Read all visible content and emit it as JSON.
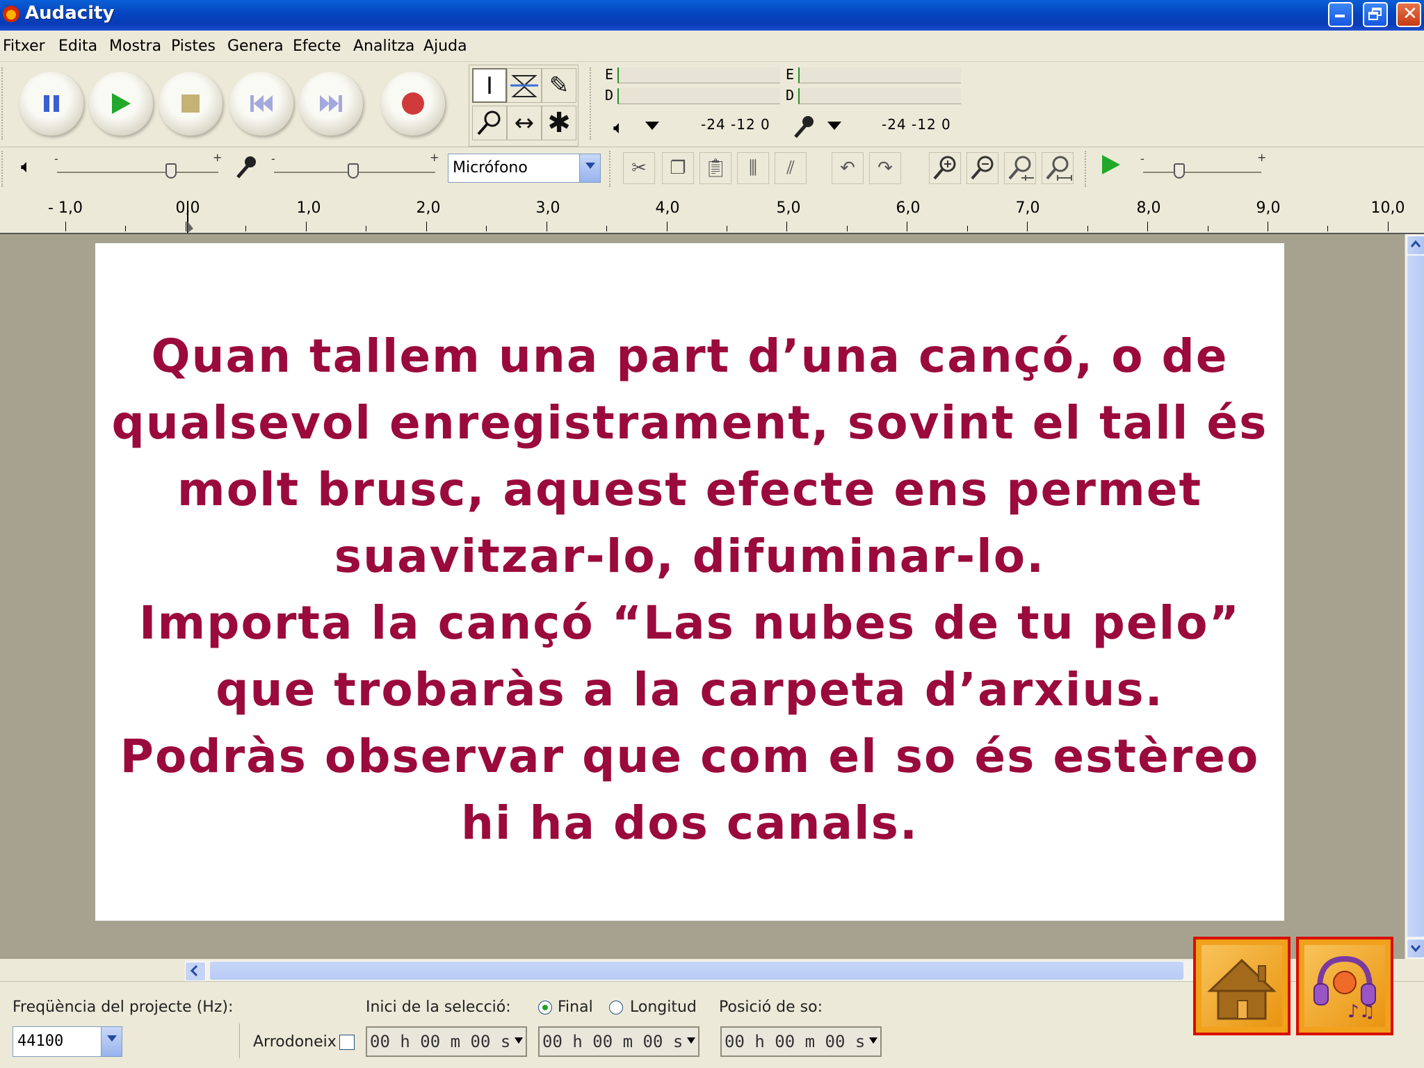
{
  "window": {
    "title": "Audacity"
  },
  "menu": [
    "Fitxer",
    "Edita",
    "Mostra",
    "Pistes",
    "Genera",
    "Efecte",
    "Analitza",
    "Ajuda"
  ],
  "icons": {
    "transport": [
      "pause-icon",
      "play-icon",
      "stop-icon",
      "skip-start-icon",
      "skip-end-icon",
      "record-icon"
    ],
    "tools": [
      "selection-tool-icon",
      "envelope-tool-icon",
      "draw-tool-icon",
      "zoom-tool-icon",
      "timeshift-tool-icon",
      "multi-tool-icon"
    ],
    "edit": [
      "trim-icon",
      "copy-icon",
      "paste-icon",
      "silence-icon",
      "split-icon",
      "undo-icon",
      "redo-icon",
      "zoom-in-icon",
      "zoom-out-icon",
      "fit-selection-icon",
      "fit-project-icon",
      "play-at-speed-icon"
    ]
  },
  "meters": {
    "output": {
      "channel_labels": [
        "E",
        "D"
      ],
      "scale": "-24  -12   0"
    },
    "input": {
      "channel_labels": [
        "E",
        "D"
      ],
      "scale": "-24  -12   0"
    }
  },
  "mixer": {
    "input_source": "Micrófono"
  },
  "ruler": {
    "labels": [
      "- 1,0",
      "0,0",
      "1,0",
      "2,0",
      "3,0",
      "4,0",
      "5,0",
      "6,0",
      "7,0",
      "8,0",
      "9,0",
      "10,0"
    ]
  },
  "slide": {
    "lines": [
      "Quan tallem una part d’una cançó, o de",
      "qualsevol enregistrament, sovint el tall és",
      "molt brusc, aquest efecte ens permet",
      "suavitzar-lo, difuminar-lo.",
      "Importa la cançó “Las nubes de tu pelo”",
      "que trobaràs a la carpeta d’arxius.",
      "Podràs observar que com el so és estèreo",
      "hi ha dos canals."
    ]
  },
  "status": {
    "project_rate_label": "Freqüència del projecte (Hz):",
    "project_rate_value": "44100",
    "snap_label": "Arrodoneix",
    "selection_start_label": "Inici de la selecció:",
    "radio_end": "Final",
    "radio_length": "Longitud",
    "audio_position_label": "Posició de so:",
    "time_start": "00 h 00 m 00 s",
    "time_end": "00 h 00 m 00 s",
    "time_position": "00 h 00 m 00 s"
  },
  "nav": {
    "home": "home-icon",
    "music": "headphones-music-icon"
  }
}
